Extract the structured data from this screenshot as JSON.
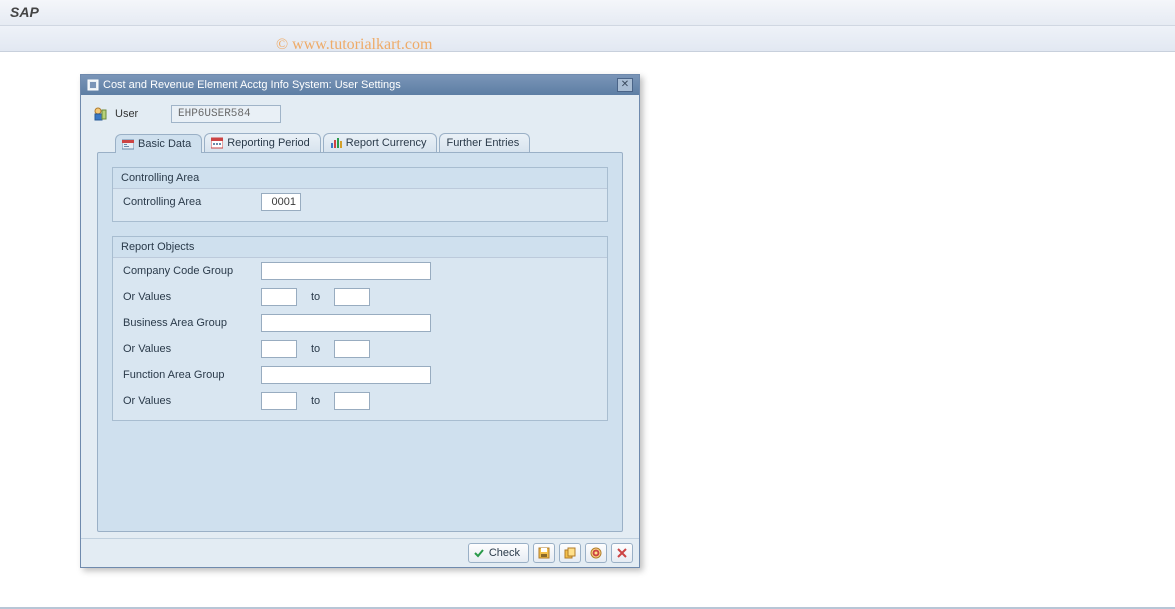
{
  "app": {
    "title": "SAP"
  },
  "watermark": "© www.tutorialkart.com",
  "dialog": {
    "title": "Cost and Revenue Element Acctg Info System: User Settings",
    "user_label": "User",
    "user_value": "EHP6USER584",
    "tabs": [
      {
        "label": "Basic Data"
      },
      {
        "label": "Reporting Period"
      },
      {
        "label": "Report Currency"
      },
      {
        "label": "Further Entries"
      }
    ],
    "group1": {
      "title": "Controlling Area",
      "field_label": "Controlling Area",
      "field_value": "0001"
    },
    "group2": {
      "title": "Report Objects",
      "rows": [
        {
          "label": "Company Code Group",
          "type": "group",
          "value": ""
        },
        {
          "label": "Or Values",
          "type": "range",
          "from": "",
          "to_label": "to",
          "to": ""
        },
        {
          "label": "Business Area Group",
          "type": "group",
          "value": ""
        },
        {
          "label": "Or Values",
          "type": "range",
          "from": "",
          "to_label": "to",
          "to": ""
        },
        {
          "label": "Function Area Group",
          "type": "group",
          "value": ""
        },
        {
          "label": "Or Values",
          "type": "range",
          "from": "",
          "to_label": "to",
          "to": ""
        }
      ]
    },
    "footer": {
      "check_label": "Check"
    }
  }
}
